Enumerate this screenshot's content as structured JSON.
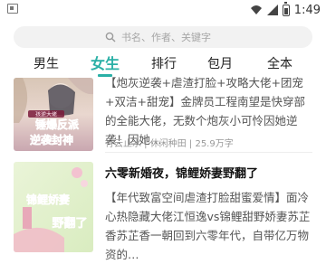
{
  "status_bar": {
    "time": "1:49",
    "icons": [
      "notification-icon",
      "wifi-icon",
      "signal-icon",
      "battery-icon"
    ]
  },
  "search": {
    "placeholder": "书名、作者、关键字",
    "icon": "search-icon"
  },
  "tabs": [
    {
      "label": "男生",
      "active": false
    },
    {
      "label": "女生",
      "active": true
    },
    {
      "label": "排行",
      "active": false
    },
    {
      "label": "包月",
      "active": false
    },
    {
      "label": "全本",
      "active": false
    }
  ],
  "colors": {
    "accent": "#2ab0a6",
    "meta_gray": "#999999",
    "desc_gray": "#555555"
  },
  "books": [
    {
      "title": "",
      "description": "【炮灰逆袭+虐渣打脸+攻略大佬+团宠+双洁+甜宠】金牌员工程南望是快穿部的全能大佬，无数个炮灰小可怜因她逆袭！因她…",
      "meta": "行云止水 | 休闲种田 | 25.9万字",
      "cover_text": [
        "孩逆大佬",
        "锤爆反派",
        "逆袭封神"
      ]
    },
    {
      "title": "六零新婚夜，锦鲤娇妻野翻了",
      "description": "【年代致富空间虐渣打脸甜蜜爱情】面冷心热隐藏大佬江恒逸vs锦鲤甜野娇妻苏芷香苏芷香一朝回到六零年代，自带亿万物资的…",
      "meta": "",
      "cover_text": [
        "锦鲤娇妻",
        "野翻了"
      ]
    }
  ]
}
